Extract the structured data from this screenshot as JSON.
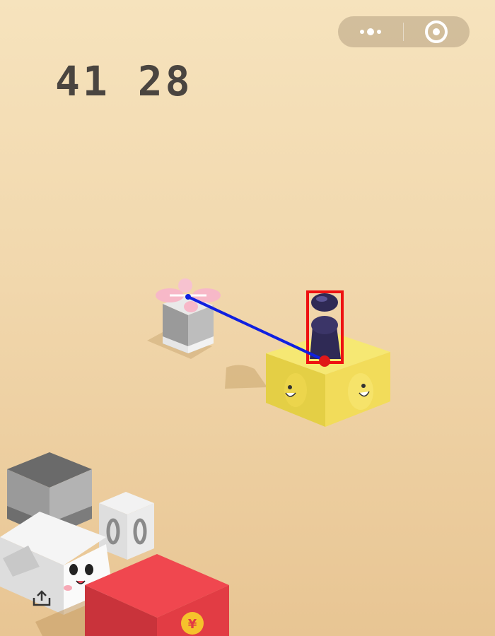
{
  "hud": {
    "score": "41 28"
  },
  "capsule": {
    "more_icon": "more-dots-icon",
    "close_icon": "target-circle-icon"
  },
  "board": {
    "target_block_label": "¥"
  },
  "colors": {
    "background_top": "#f6e3bd",
    "background_bottom": "#e8c593",
    "score_text": "#4a4540",
    "yellow_block": "#f2dc5a",
    "red_block": "#f0474f",
    "trajectory_line": "#1020e0",
    "highlight_box": "#ee1111",
    "player_piece": "#2f2a55",
    "ribbon": "#f7b8c8"
  }
}
